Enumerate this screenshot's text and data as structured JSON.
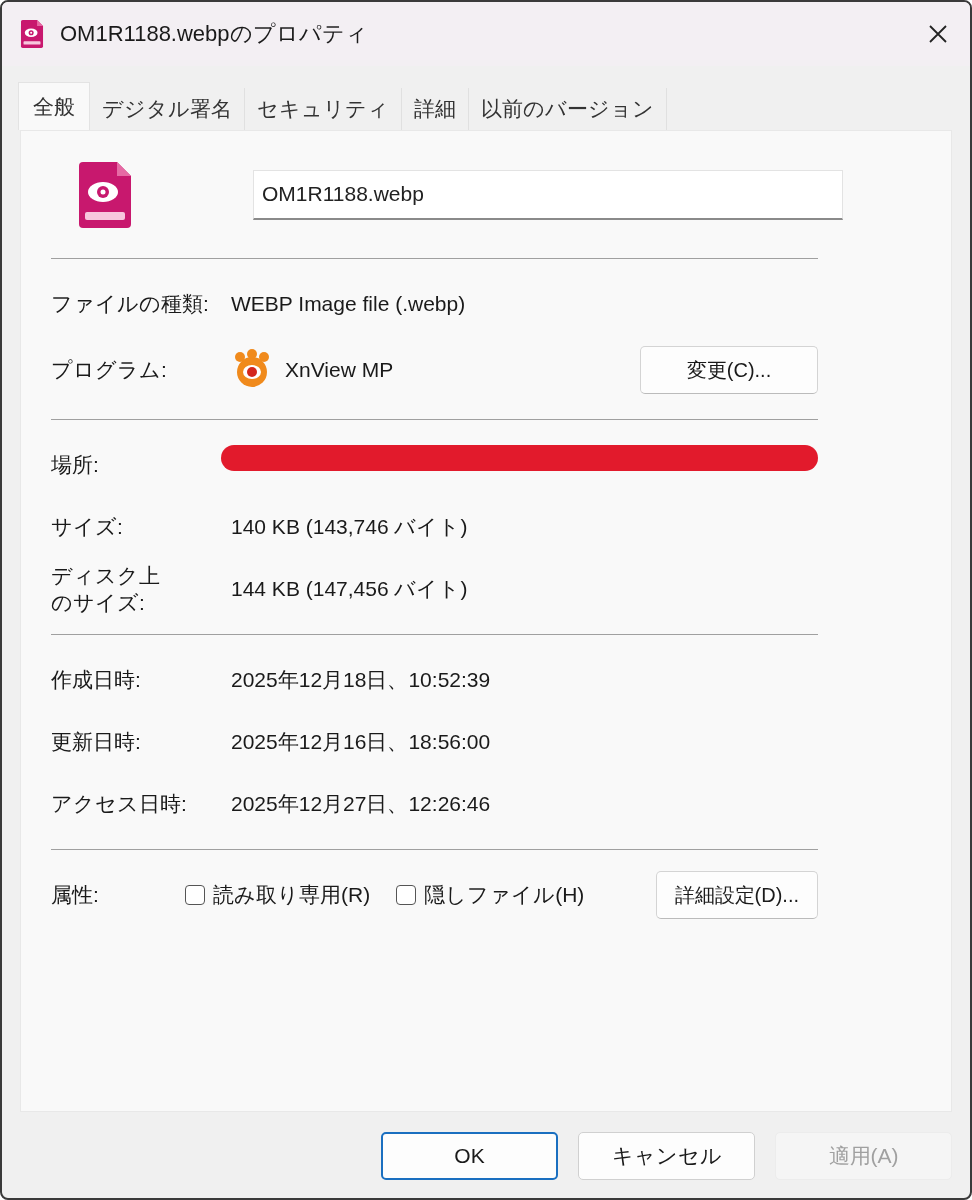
{
  "window": {
    "title": "OM1R1188.webpのプロパティ"
  },
  "tabs": [
    {
      "label": "全般",
      "selected": true
    },
    {
      "label": "デジタル署名",
      "selected": false
    },
    {
      "label": "セキュリティ",
      "selected": false
    },
    {
      "label": "詳細",
      "selected": false
    },
    {
      "label": "以前のバージョン",
      "selected": false
    }
  ],
  "file_name": "OM1R1188.webp",
  "sections": [
    [
      {
        "kind": "text",
        "label": "ファイルの種類:",
        "value": "WEBP Image file (.webp)"
      },
      {
        "kind": "program",
        "label": "プログラム:",
        "value": "XnView MP",
        "button": "変更(C)..."
      }
    ],
    [
      {
        "kind": "redacted",
        "label": "場所:",
        "redacted": true
      },
      {
        "kind": "text",
        "label": "サイズ:",
        "value": "140 KB (143,746 バイト)"
      },
      {
        "kind": "text",
        "label": [
          "ディスク上",
          "のサイズ:"
        ],
        "value": "144 KB (147,456 バイト)"
      }
    ],
    [
      {
        "kind": "text",
        "label": "作成日時:",
        "value": "2025年12月18日、10:52:39"
      },
      {
        "kind": "text",
        "label": "更新日時:",
        "value": "2025年12月16日、18:56:00"
      },
      {
        "kind": "text",
        "label": "アクセス日時:",
        "value": "2025年12月27日、12:26:46"
      }
    ],
    [
      {
        "kind": "attributes",
        "label": "属性:",
        "checkboxes": [
          {
            "label": "読み取り専用(R)",
            "checked": false
          },
          {
            "label": "隠しファイル(H)",
            "checked": false
          }
        ],
        "button": "詳細設定(D)..."
      }
    ]
  ],
  "buttons": [
    {
      "label": "OK",
      "default": true,
      "disabled": false
    },
    {
      "label": "キャンセル",
      "default": false,
      "disabled": false
    },
    {
      "label": "適用(A)",
      "default": false,
      "disabled": true
    }
  ]
}
